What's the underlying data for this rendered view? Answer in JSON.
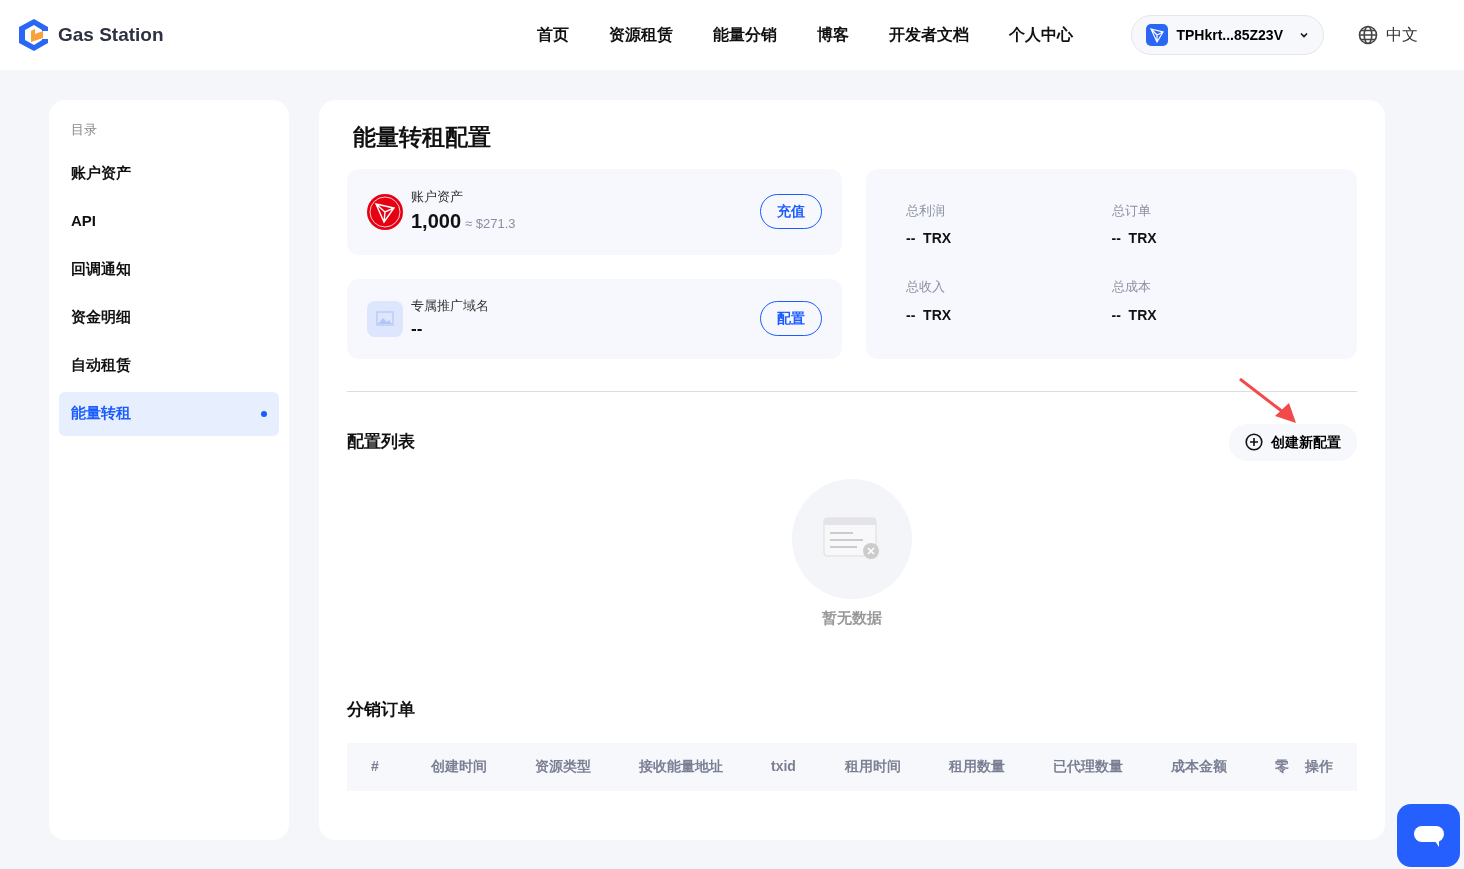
{
  "brand": {
    "name": "Gas Station"
  },
  "nav": [
    {
      "label": "首页"
    },
    {
      "label": "资源租赁"
    },
    {
      "label": "能量分销"
    },
    {
      "label": "博客"
    },
    {
      "label": "开发者文档"
    },
    {
      "label": "个人中心"
    }
  ],
  "wallet": {
    "address": "TPHkrt...85Z23V"
  },
  "language": {
    "label": "中文"
  },
  "sidebar": {
    "heading": "目录",
    "items": [
      {
        "label": "账户资产",
        "selected": false
      },
      {
        "label": "API",
        "selected": false
      },
      {
        "label": "回调通知",
        "selected": false
      },
      {
        "label": "资金明细",
        "selected": false
      },
      {
        "label": "自动租赁",
        "selected": false
      },
      {
        "label": "能量转租",
        "selected": true
      }
    ]
  },
  "page_title": "能量转租配置",
  "asset_card": {
    "label": "账户资产",
    "amount": "1,000",
    "approx": "≈ $271.3",
    "button": "充值"
  },
  "domain_card": {
    "label": "专属推广域名",
    "value": "--",
    "button": "配置"
  },
  "stats": [
    {
      "label": "总利润",
      "value": "--",
      "unit": "TRX"
    },
    {
      "label": "总订单",
      "value": "--",
      "unit": "TRX"
    },
    {
      "label": "总收入",
      "value": "--",
      "unit": "TRX"
    },
    {
      "label": "总成本",
      "value": "--",
      "unit": "TRX"
    }
  ],
  "config_list": {
    "title": "配置列表",
    "create_button": "创建新配置",
    "empty_text": "暂无数据"
  },
  "orders": {
    "title": "分销订单",
    "columns": [
      "#",
      "创建时间",
      "资源类型",
      "接收能量地址",
      "txid",
      "租用时间",
      "租用数量",
      "已代理数量",
      "成本金额",
      "零",
      "操作"
    ]
  }
}
